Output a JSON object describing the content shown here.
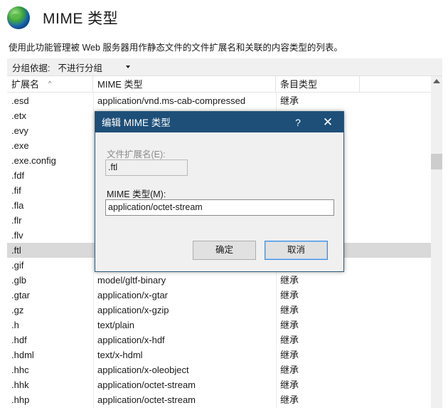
{
  "header": {
    "icon": "globe-icon",
    "title": "MIME 类型"
  },
  "description": "使用此功能管理被 Web 服务器用作静态文件的文件扩展名和关联的内容类型的列表。",
  "groupby": {
    "label": "分组依据:",
    "value": "不进行分组"
  },
  "table": {
    "columns": [
      "扩展名",
      "MIME 类型",
      "条目类型"
    ],
    "selected_index": 10,
    "rows": [
      {
        "ext": ".esd",
        "mime": "application/vnd.ms-cab-compressed",
        "type": "继承"
      },
      {
        "ext": ".etx",
        "mime": "",
        "type": ""
      },
      {
        "ext": ".evy",
        "mime": "",
        "type": ""
      },
      {
        "ext": ".exe",
        "mime": "",
        "type": ""
      },
      {
        "ext": ".exe.config",
        "mime": "",
        "type": ""
      },
      {
        "ext": ".fdf",
        "mime": "",
        "type": ""
      },
      {
        "ext": ".fif",
        "mime": "",
        "type": ""
      },
      {
        "ext": ".fla",
        "mime": "",
        "type": ""
      },
      {
        "ext": ".flr",
        "mime": "",
        "type": ""
      },
      {
        "ext": ".flv",
        "mime": "",
        "type": ""
      },
      {
        "ext": ".ftl",
        "mime": "",
        "type": ""
      },
      {
        "ext": ".gif",
        "mime": "",
        "type": ""
      },
      {
        "ext": ".glb",
        "mime": "model/gltf-binary",
        "type": "继承"
      },
      {
        "ext": ".gtar",
        "mime": "application/x-gtar",
        "type": "继承"
      },
      {
        "ext": ".gz",
        "mime": "application/x-gzip",
        "type": "继承"
      },
      {
        "ext": ".h",
        "mime": "text/plain",
        "type": "继承"
      },
      {
        "ext": ".hdf",
        "mime": "application/x-hdf",
        "type": "继承"
      },
      {
        "ext": ".hdml",
        "mime": "text/x-hdml",
        "type": "继承"
      },
      {
        "ext": ".hhc",
        "mime": "application/x-oleobject",
        "type": "继承"
      },
      {
        "ext": ".hhk",
        "mime": "application/octet-stream",
        "type": "继承"
      },
      {
        "ext": ".hhp",
        "mime": "application/octet-stream",
        "type": "继承"
      }
    ]
  },
  "dialog": {
    "title": "编辑 MIME 类型",
    "help": "?",
    "close": "✕",
    "ext_label": "文件扩展名(E):",
    "ext_value": ".ftl",
    "mime_label": "MIME 类型(M):",
    "mime_value": "application/octet-stream",
    "ok_label": "确定",
    "cancel_label": "取消"
  }
}
